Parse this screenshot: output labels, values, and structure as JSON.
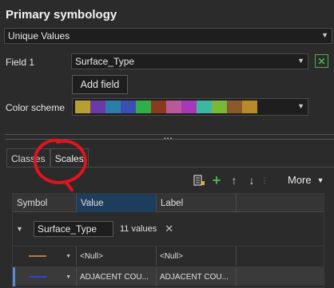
{
  "panel": {
    "title": "Primary symbology",
    "symbology_type": "Unique Values"
  },
  "field": {
    "label": "Field 1",
    "value": "Surface_Type",
    "add_field_label": "Add field"
  },
  "color_scheme": {
    "label": "Color scheme",
    "swatches": [
      "#b8a030",
      "#6a3aa8",
      "#2b7ea8",
      "#3a4fb0",
      "#2fae4a",
      "#8a3a1e",
      "#b85a9a",
      "#a838b8",
      "#3ab8a0",
      "#7ab838",
      "#8a5a2a",
      "#b88a2a"
    ]
  },
  "tabs": [
    {
      "label": "Classes"
    },
    {
      "label": "Scales"
    }
  ],
  "toolbar": {
    "more_label": "More"
  },
  "grid": {
    "columns": [
      "Symbol",
      "Value",
      "Label"
    ],
    "group_field": "Surface_Type",
    "group_count": "11 values",
    "rows": [
      {
        "value": "<Null>",
        "label": "<Null>",
        "color": "#b87a3a"
      },
      {
        "value": "ADJACENT COU...",
        "label": "ADJACENT COU...",
        "color": "#3a3ae0"
      }
    ]
  },
  "colors": {
    "annotation": "#e0141e",
    "accent_selected": "#1d3d5c",
    "valid": "#4caf50"
  }
}
